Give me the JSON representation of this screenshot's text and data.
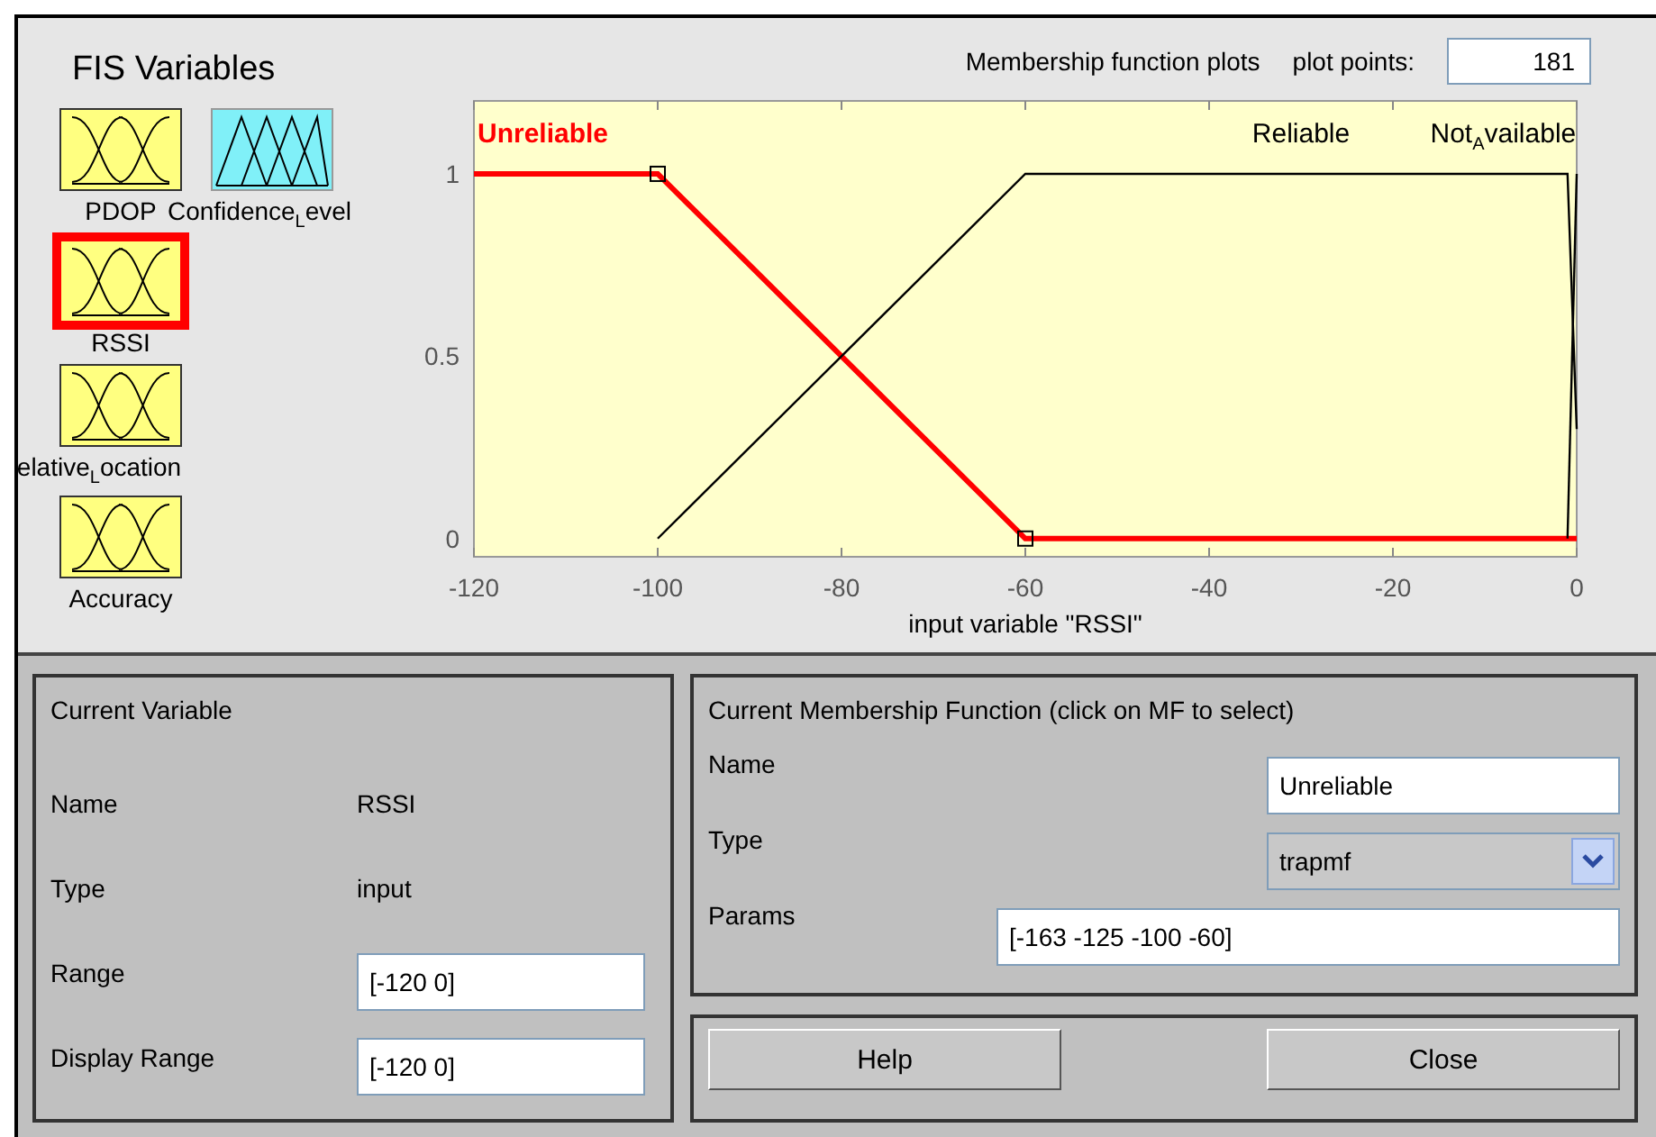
{
  "variables_panel": {
    "title": "FIS Variables",
    "items": [
      {
        "label": "PDOP",
        "kind": "input",
        "selected": false
      },
      {
        "label": "Confidence$_{L}$evel",
        "kind": "output",
        "selected": false
      },
      {
        "label": "RSSI",
        "kind": "input",
        "selected": true
      },
      {
        "label": "elative$_{L}$ocation",
        "kind": "input",
        "selected": false
      },
      {
        "label": "Accuracy",
        "kind": "input",
        "selected": false
      }
    ]
  },
  "plot": {
    "title": "Membership function plots",
    "plot_points_label": "plot points:",
    "plot_points": "181",
    "chart_data": {
      "type": "line",
      "xlabel": "input variable \"RSSI\"",
      "x": [
        -120,
        -100,
        -60,
        -1,
        0
      ],
      "xlim": [
        -120,
        0
      ],
      "ylim": [
        -0.05,
        1.2
      ],
      "xticks": [
        -120,
        -100,
        -80,
        -60,
        -40,
        -20,
        0
      ],
      "yticks": [
        0,
        0.5,
        1
      ],
      "series": [
        {
          "name": "Unreliable",
          "color": "#ff0000",
          "values": [
            1,
            1,
            0,
            0,
            0
          ]
        },
        {
          "name": "Reliable",
          "color": "#000000",
          "values": [
            null,
            0,
            1,
            1,
            0.3
          ]
        },
        {
          "name": "Not$_{A}$vailable",
          "color": "#000000",
          "values": [
            null,
            null,
            null,
            0,
            1
          ]
        }
      ]
    },
    "mf_states": [
      {
        "selected": true
      },
      {
        "selected": false
      },
      {
        "selected": false
      }
    ]
  },
  "current_variable": {
    "title": "Current Variable",
    "fields": [
      {
        "label": "Name",
        "value": "RSSI",
        "kind": "text"
      },
      {
        "label": "Type",
        "value": "input",
        "kind": "text"
      },
      {
        "label": "Range",
        "value": "[-120 0]",
        "kind": "input"
      },
      {
        "label": "Display Range",
        "value": "[-120 0]",
        "kind": "input"
      }
    ]
  },
  "current_mf": {
    "title": "Current Membership Function (click on MF to select)",
    "fields": [
      {
        "label": "Name",
        "value": "Unreliable",
        "kind": "input"
      },
      {
        "label": "Type",
        "value": "trapmf",
        "kind": "select"
      },
      {
        "label": "Params",
        "value": "[-163 -125 -100 -60]",
        "kind": "wide"
      }
    ]
  },
  "buttons": [
    "Help",
    "Close"
  ]
}
